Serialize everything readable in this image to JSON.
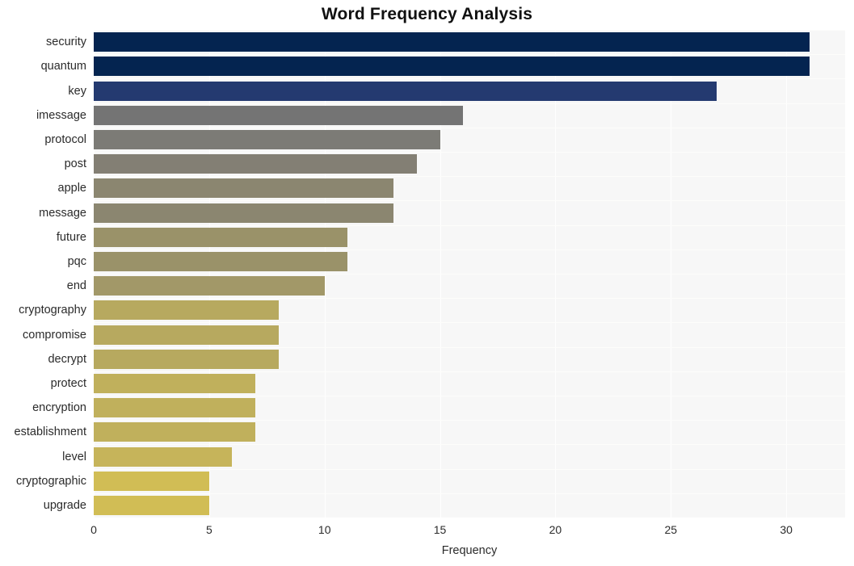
{
  "chart_data": {
    "type": "bar",
    "orientation": "horizontal",
    "title": "Word Frequency Analysis",
    "xlabel": "Frequency",
    "ylabel": "",
    "xlim": [
      0,
      32.55
    ],
    "xticks": [
      0,
      5,
      10,
      15,
      20,
      25,
      30
    ],
    "xtick_labels": [
      "0",
      "5",
      "10",
      "15",
      "20",
      "25",
      "30"
    ],
    "grid": true,
    "grid_axis": "both",
    "legend": false,
    "categories": [
      "security",
      "quantum",
      "key",
      "imessage",
      "protocol",
      "post",
      "apple",
      "message",
      "future",
      "pqc",
      "end",
      "cryptography",
      "compromise",
      "decrypt",
      "protect",
      "encryption",
      "establishment",
      "level",
      "cryptographic",
      "upgrade"
    ],
    "values": [
      31,
      31,
      27,
      16,
      15,
      14,
      13,
      13,
      11,
      11,
      10,
      8,
      8,
      8,
      7,
      7,
      7,
      6,
      5,
      5
    ],
    "bar_colors": [
      "#042450",
      "#042450",
      "#243a70",
      "#747474",
      "#7c7b76",
      "#837f74",
      "#8b8670",
      "#8b8670",
      "#9a9269",
      "#9a9269",
      "#a29868",
      "#b7a95f",
      "#b7a95f",
      "#b7a95f",
      "#c0b05c",
      "#c0b05c",
      "#c0b05c",
      "#c6b45a",
      "#d1bd55",
      "#d1bd55"
    ],
    "plot_background": "#f7f7f7",
    "figure_background": "#ffffff",
    "gridline_color": "#ffffff"
  }
}
